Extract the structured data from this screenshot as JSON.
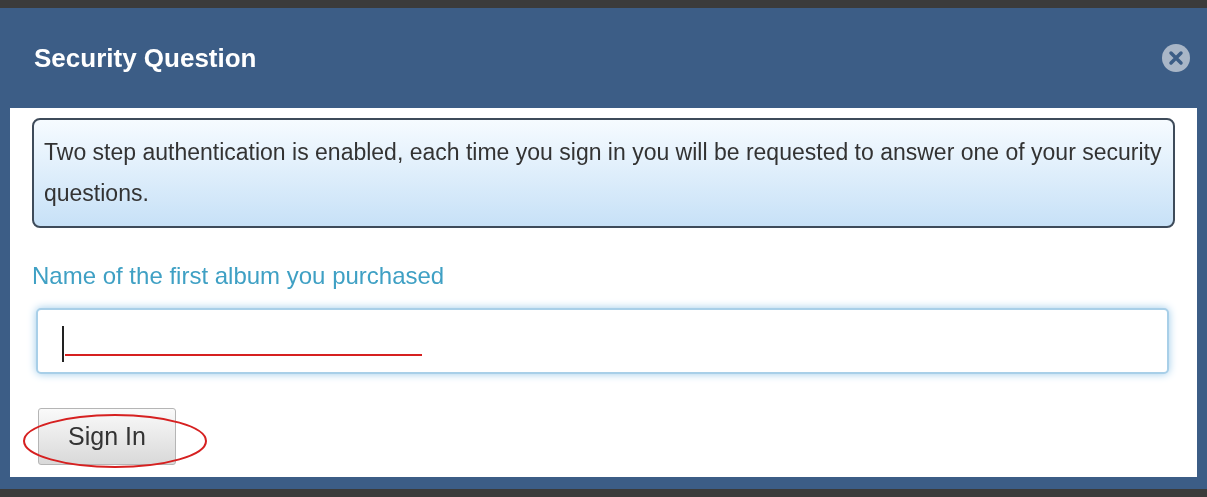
{
  "dialog": {
    "title": "Security Question",
    "message": "Two step authentication is enabled, each time you sign in you will be requested to answer one of your security questions.",
    "question_label": "Name of the first album you purchased",
    "answer": {
      "focused": true
    },
    "submit_button": "Sign In"
  }
}
